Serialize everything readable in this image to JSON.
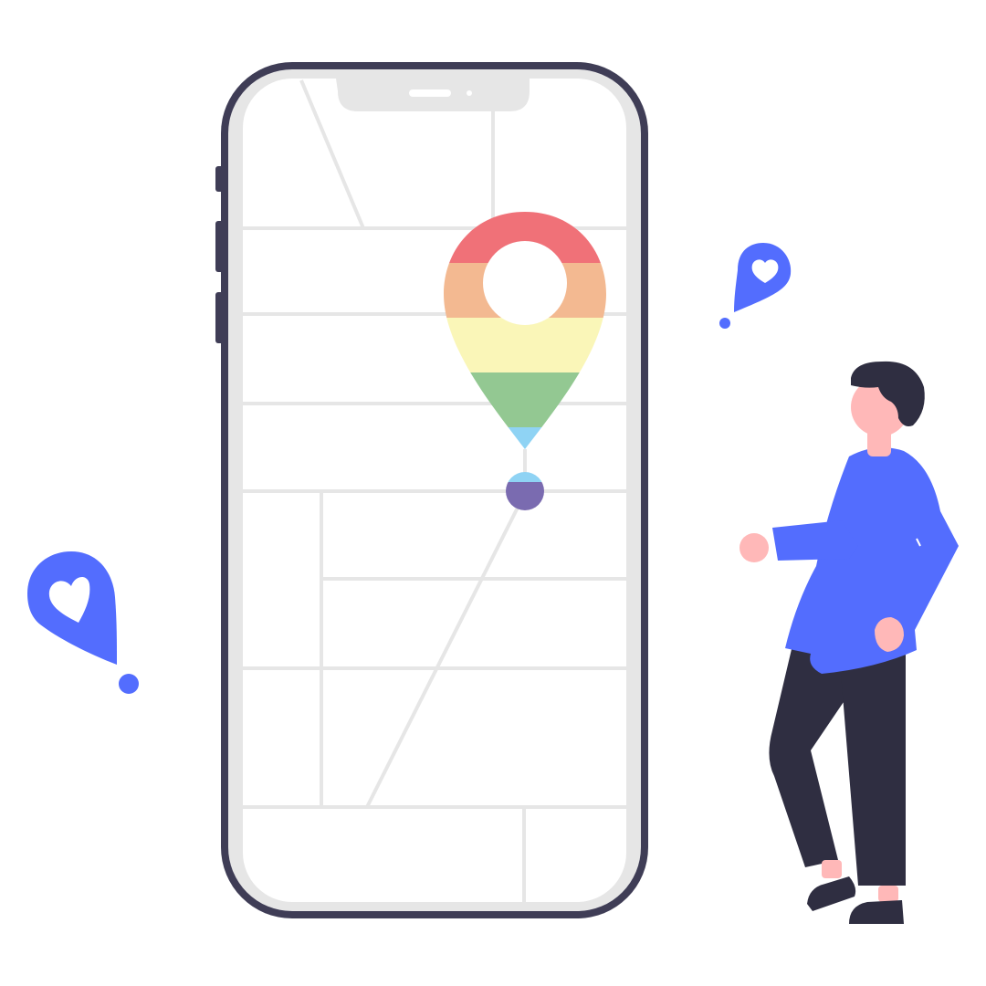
{
  "colors": {
    "background": "#ffffff",
    "phone_frame": "#3f3d56",
    "phone_bezel": "#e6e6e6",
    "screen": "#ffffff",
    "map_lines": "#e6e6e6",
    "accent_blue": "#536dfe",
    "person_dark": "#2f2e41",
    "skin": "#ffb8b8",
    "pin_rainbow": [
      "#f07178",
      "#f3b991",
      "#faf6b8",
      "#93c892",
      "#8fd3f4",
      "#7a6bb0"
    ]
  },
  "icons": [
    "location-pin-icon",
    "heart-icon",
    "phone-illustration",
    "person-illustration"
  ]
}
